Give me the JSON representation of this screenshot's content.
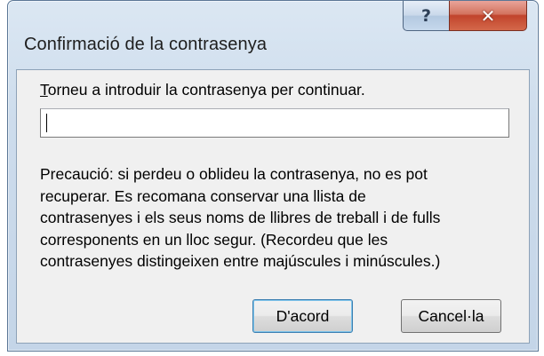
{
  "window": {
    "title": "Confirmació de la contrasenya",
    "help_glyph": "?",
    "close_glyph": "✕",
    "help_icon": "help-icon",
    "close_icon": "close-icon"
  },
  "prompt": {
    "label_first_letter": "T",
    "label_rest": "orneu a introduir la contrasenya per continuar."
  },
  "password": {
    "value": "",
    "placeholder": ""
  },
  "warning_text": "Precaució: si perdeu o oblideu la contrasenya, no es pot\nrecuperar. Es recomana conservar una llista de\ncontrasenyes i els seus noms de llibres de treball i de fulls\ncorresponents en un lloc segur. (Recordeu que les\ncontrasenyes distingeixen entre majúscules i minúscules.)",
  "buttons": {
    "ok": "D'acord",
    "cancel": "Cancel·la"
  },
  "colors": {
    "frame": "#cddcec",
    "client": "#f0f0f0",
    "close_button": "#c1442c",
    "default_button_focus": "#3c7fb1"
  }
}
